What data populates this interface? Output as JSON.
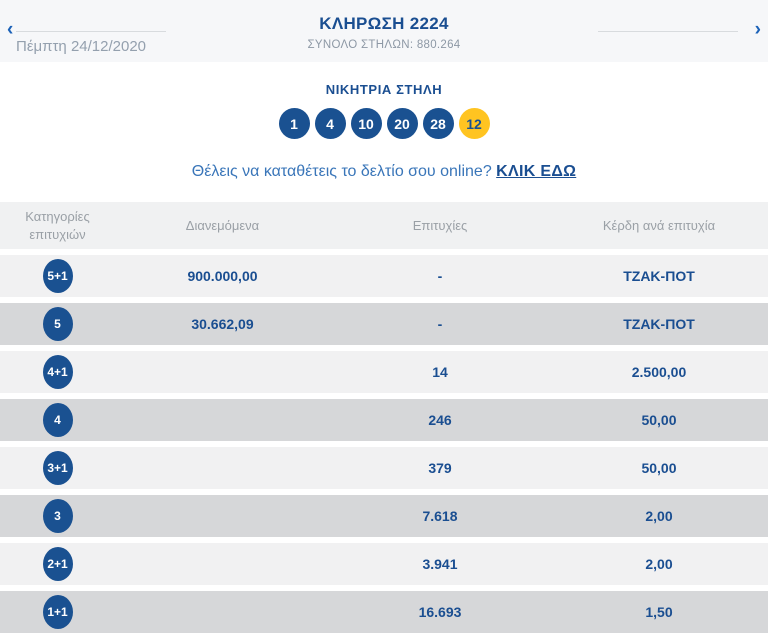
{
  "header": {
    "prev_arrow": "‹",
    "next_arrow": "›",
    "date": "Πέμπτη 24/12/2020",
    "title": "ΚΛΗΡΩΣΗ 2224",
    "total_columns": "ΣΥΝΟΛΟ ΣΤΗΛΩΝ: 880.264"
  },
  "winning": {
    "label": "ΝΙΚΗΤΡΙΑ ΣΤΗΛΗ",
    "numbers": [
      "1",
      "4",
      "10",
      "20",
      "28"
    ],
    "joker": "12"
  },
  "cta": {
    "text": "Θέλεις να καταθέτεις το δελτίο σου online? ",
    "link_label": "ΚΛΙΚ ΕΔΩ"
  },
  "table": {
    "headers": {
      "category": "Κατηγορίες επιτυχιών",
      "distributed": "Διανεμόμενα",
      "winners": "Επιτυχίες",
      "prize": "Κέρδη ανά επιτυχία"
    },
    "rows": [
      {
        "category": "5+1",
        "distributed": "900.000,00",
        "winners": "-",
        "prize": "ΤΖΑΚ-ΠΟΤ"
      },
      {
        "category": "5",
        "distributed": "30.662,09",
        "winners": "-",
        "prize": "ΤΖΑΚ-ΠΟΤ"
      },
      {
        "category": "4+1",
        "distributed": "",
        "winners": "14",
        "prize": "2.500,00"
      },
      {
        "category": "4",
        "distributed": "",
        "winners": "246",
        "prize": "50,00"
      },
      {
        "category": "3+1",
        "distributed": "",
        "winners": "379",
        "prize": "50,00"
      },
      {
        "category": "3",
        "distributed": "",
        "winners": "7.618",
        "prize": "2,00"
      },
      {
        "category": "2+1",
        "distributed": "",
        "winners": "3.941",
        "prize": "2,00"
      },
      {
        "category": "1+1",
        "distributed": "",
        "winners": "16.693",
        "prize": "1,50"
      }
    ]
  },
  "colors": {
    "primary_blue": "#1a5191",
    "link_blue": "#3a76b9",
    "joker_yellow": "#ffc421",
    "row_light": "#f1f1f2",
    "row_dark": "#d6d7d9",
    "band_gray": "#f6f7f9",
    "muted_text": "#9aa0a6"
  }
}
